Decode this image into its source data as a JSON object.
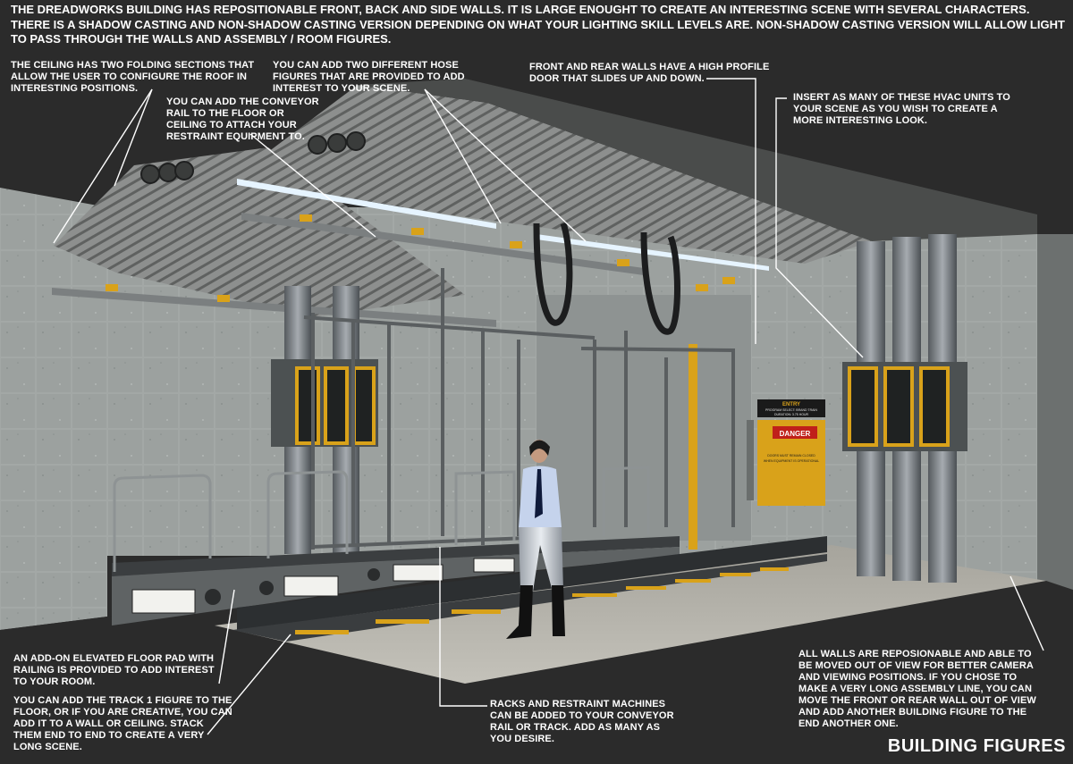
{
  "header": {
    "intro": "THE DREADWORKS BUILDING HAS REPOSITIONABLE FRONT, BACK AND SIDE WALLS. IT IS LARGE ENOUGHT TO CREATE AN INTERESTING SCENE WITH SEVERAL CHARACTERS. THERE IS A SHADOW CASTING AND NON-SHADOW CASTING VERSION DEPENDING ON WHAT YOUR LIGHTING SKILL LEVELS ARE.  NON-SHADOW CASTING VERSION WILL ALLOW LIGHT TO PASS THROUGH THE WALLS AND ASSEMBLY / ROOM FIGURES."
  },
  "callouts": {
    "ceiling": "THE CEILING HAS TWO FOLDING SECTIONS THAT ALLOW THE USER TO CONFIGURE THE ROOF IN INTERESTING POSITIONS.",
    "hose": "YOU CAN ADD TWO DIFFERENT HOSE FIGURES THAT ARE PROVIDED TO ADD INTEREST TO YOUR SCENE.",
    "doors": "FRONT AND REAR WALLS HAVE A HIGH PROFILE DOOR THAT SLIDES UP AND DOWN.",
    "conveyor": "YOU CAN ADD THE CONVEYOR RAIL TO THE FLOOR OR CEILING TO ATTACH YOUR RESTRAINT EQUIPMENT TO.",
    "hvac": "INSERT AS MANY OF THESE HVAC UNITS TO YOUR SCENE AS YOU WISH TO CREATE A MORE INTERESTING LOOK.",
    "floor_pad": "AN ADD-ON ELEVATED FLOOR PAD WITH RAILING IS PROVIDED TO ADD INTEREST TO YOUR ROOM.",
    "track": "YOU CAN ADD THE TRACK 1 FIGURE TO THE FLOOR, OR IF YOU ARE CREATIVE, YOU CAN ADD IT TO A WALL OR CEILING. STACK THEM END TO END TO CREATE A VERY LONG SCENE.",
    "racks": "RACKS AND RESTRAINT MACHINES CAN BE ADDED TO YOUR CONVEYOR RAIL OR TRACK.  ADD AS MANY AS YOU DESIRE.",
    "walls": "ALL WALLS ARE REPOSIONABLE AND ABLE TO BE MOVED OUT OF VIEW FOR BETTER CAMERA AND VIEWING POSITIONS.  IF YOU CHOSE TO MAKE A VERY LONG ASSEMBLY LINE, YOU CAN MOVE THE FRONT OR REAR WALL OUT OF VIEW AND ADD ANOTHER BUILDING FIGURE TO THE END ANOTHER ONE."
  },
  "sign": {
    "title": "ENTRY",
    "line1": "PROGRAM SELECT: BRAND TRAIN",
    "line2": "DURATION: 3.75 HOUR",
    "danger": "DANGER",
    "warn1": "DOORS MUST REMAIN CLOSED",
    "warn2": "WHEN EQUIPMENT IS OPERATIONAL"
  },
  "footer": {
    "title": "BUILDING FIGURES"
  },
  "colors": {
    "background": "#2b2b2b",
    "text": "#ffffff",
    "accent_yellow": "#d9a21a",
    "danger_red": "#c0201a",
    "wall": "#9aa09e"
  }
}
